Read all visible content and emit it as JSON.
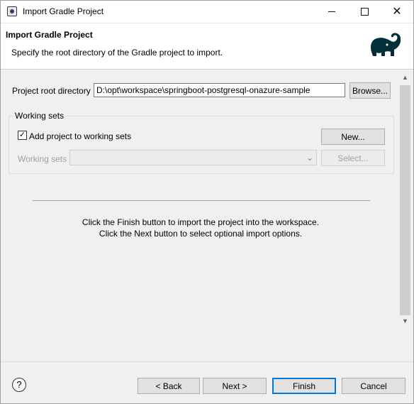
{
  "window": {
    "title": "Import Gradle Project",
    "controls": {
      "minimize": "—",
      "maximize": "☐",
      "close": "✕"
    }
  },
  "banner": {
    "title": "Import Gradle Project",
    "description": "Specify the root directory of the Gradle project to import.",
    "logo_icon": "gradle-elephant-icon"
  },
  "form": {
    "root_label": "Project root directory",
    "root_value": "D:\\opt\\workspace\\springboot-postgresql-onazure-sample",
    "browse_label": "Browse...",
    "working_sets_group": "Working sets",
    "add_to_working_sets_checked": true,
    "add_to_working_sets_label": "Add project to working sets",
    "new_label": "New...",
    "working_sets_label": "Working sets",
    "working_sets_value": "",
    "select_label": "Select..."
  },
  "info": {
    "line1": "Click the Finish button to import the project into the workspace.",
    "line2": "Click the Next button to select optional import options."
  },
  "footer": {
    "help_symbol": "?",
    "back_label": "< Back",
    "next_label": "Next >",
    "finish_label": "Finish",
    "cancel_label": "Cancel"
  },
  "colors": {
    "accent": "#0078d7",
    "logo": "#02303a"
  }
}
